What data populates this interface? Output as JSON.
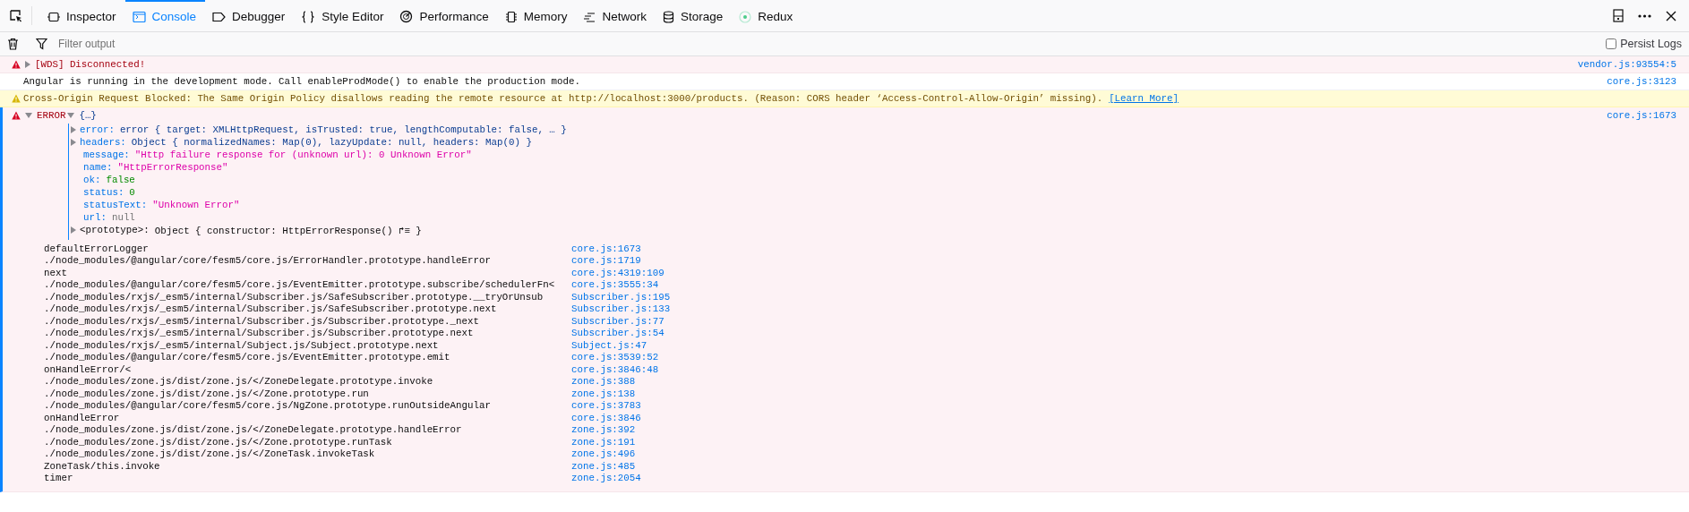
{
  "toolbar": {
    "tabs": [
      {
        "label": "Inspector",
        "selected": false
      },
      {
        "label": "Console",
        "selected": true
      },
      {
        "label": "Debugger",
        "selected": false
      },
      {
        "label": "Style Editor",
        "selected": false
      },
      {
        "label": "Performance",
        "selected": false
      },
      {
        "label": "Memory",
        "selected": false
      },
      {
        "label": "Network",
        "selected": false
      },
      {
        "label": "Storage",
        "selected": false
      },
      {
        "label": "Redux",
        "selected": false
      }
    ]
  },
  "filter_bar": {
    "placeholder": "Filter output",
    "persist_logs": {
      "label": "Persist Logs",
      "checked": false
    }
  },
  "messages": [
    {
      "kind": "error",
      "expanded": false,
      "text": "[WDS] Disconnected!",
      "source": "vendor.js:93554:5"
    },
    {
      "kind": "log",
      "text": "Angular is running in the development mode. Call enableProdMode() to enable the production mode.",
      "source": "core.js:3123"
    },
    {
      "kind": "warning",
      "text": "Cross-Origin Request Blocked: The Same Origin Policy disallows reading the remote resource at http://localhost:3000/products. (Reason: CORS header ‘Access-Control-Allow-Origin’ missing).",
      "link": "[Learn More]"
    },
    {
      "kind": "error",
      "expanded": true,
      "text": "ERROR",
      "summary": "{…}",
      "source": "core.js:1673",
      "properties": [
        {
          "key": "error:",
          "value": "error { target: XMLHttpRequest, isTrusted: true, lengthComputable: false, … }",
          "kind": "object",
          "expanded": false
        },
        {
          "key": "headers:",
          "value": "Object { normalizedNames: Map(0), lazyUpdate: null, headers: Map(0) }",
          "kind": "object",
          "expanded": false
        },
        {
          "key": "message:",
          "value": "\"Http failure response for (unknown url): 0 Unknown Error\"",
          "kind": "string"
        },
        {
          "key": "name:",
          "value": "\"HttpErrorResponse\"",
          "kind": "string"
        },
        {
          "key": "ok:",
          "value": "false",
          "kind": "boolean"
        },
        {
          "key": "status:",
          "value": "0",
          "kind": "number"
        },
        {
          "key": "statusText:",
          "value": "\"Unknown Error\"",
          "kind": "string"
        },
        {
          "key": "url:",
          "value": "null",
          "kind": "null"
        },
        {
          "key": "<prototype>:",
          "value": "Object { constructor: HttpErrorResponse() ↱≡  }",
          "kind": "prototype",
          "expanded": false
        }
      ],
      "stack": [
        {
          "fn": "defaultErrorLogger",
          "source": "core.js:1673"
        },
        {
          "fn": "./node_modules/@angular/core/fesm5/core.js/ErrorHandler.prototype.handleError",
          "source": "core.js:1719"
        },
        {
          "fn": "next",
          "source": "core.js:4319:109"
        },
        {
          "fn": "./node_modules/@angular/core/fesm5/core.js/EventEmitter.prototype.subscribe/schedulerFn<",
          "source": "core.js:3555:34"
        },
        {
          "fn": "./node_modules/rxjs/_esm5/internal/Subscriber.js/SafeSubscriber.prototype.__tryOrUnsub",
          "source": "Subscriber.js:195"
        },
        {
          "fn": "./node_modules/rxjs/_esm5/internal/Subscriber.js/SafeSubscriber.prototype.next",
          "source": "Subscriber.js:133"
        },
        {
          "fn": "./node_modules/rxjs/_esm5/internal/Subscriber.js/Subscriber.prototype._next",
          "source": "Subscriber.js:77"
        },
        {
          "fn": "./node_modules/rxjs/_esm5/internal/Subscriber.js/Subscriber.prototype.next",
          "source": "Subscriber.js:54"
        },
        {
          "fn": "./node_modules/rxjs/_esm5/internal/Subject.js/Subject.prototype.next",
          "source": "Subject.js:47"
        },
        {
          "fn": "./node_modules/@angular/core/fesm5/core.js/EventEmitter.prototype.emit",
          "source": "core.js:3539:52"
        },
        {
          "fn": "onHandleError/<",
          "source": "core.js:3846:48"
        },
        {
          "fn": "./node_modules/zone.js/dist/zone.js/</ZoneDelegate.prototype.invoke",
          "source": "zone.js:388"
        },
        {
          "fn": "./node_modules/zone.js/dist/zone.js/</Zone.prototype.run",
          "source": "zone.js:138"
        },
        {
          "fn": "./node_modules/@angular/core/fesm5/core.js/NgZone.prototype.runOutsideAngular",
          "source": "core.js:3783"
        },
        {
          "fn": "onHandleError",
          "source": "core.js:3846"
        },
        {
          "fn": "./node_modules/zone.js/dist/zone.js/</ZoneDelegate.prototype.handleError",
          "source": "zone.js:392"
        },
        {
          "fn": "./node_modules/zone.js/dist/zone.js/</Zone.prototype.runTask",
          "source": "zone.js:191"
        },
        {
          "fn": "./node_modules/zone.js/dist/zone.js/</ZoneTask.invokeTask",
          "source": "zone.js:496"
        },
        {
          "fn": "ZoneTask/this.invoke",
          "source": "zone.js:485"
        },
        {
          "fn": "timer",
          "source": "zone.js:2054"
        }
      ]
    }
  ]
}
